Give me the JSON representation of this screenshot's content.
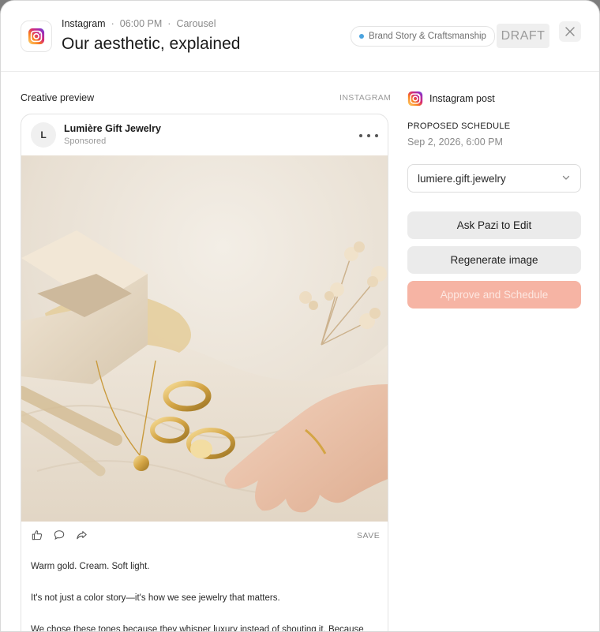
{
  "header": {
    "platform": "Instagram",
    "separator": "·",
    "time": "06:00 PM",
    "format": "Carousel",
    "title": "Our aesthetic, explained",
    "tag": "Brand Story & Craftsmanship",
    "tag_color": "#4aa3df",
    "status": "DRAFT",
    "close_icon": "close-icon"
  },
  "preview": {
    "section_label": "Creative preview",
    "section_platform": "INSTAGRAM",
    "avatar_initial": "L",
    "account_name": "Lumière Gift Jewelry",
    "sponsored_label": "Sponsored",
    "more_icon": "more-icon",
    "image_icon": "jewelry-photo",
    "action_icons": [
      "like-icon",
      "comment-icon",
      "share-icon"
    ],
    "save_label": "SAVE",
    "caption": [
      "Warm gold. Cream. Soft light.",
      "It's not just a color story—it's how we see jewelry that matters.",
      "We chose these tones because they whisper luxury instead of shouting it. Because"
    ]
  },
  "sidebar": {
    "post_kind": "Instagram post",
    "schedule_label": "PROPOSED SCHEDULE",
    "schedule_value": "Sep 2, 2026, 6:00 PM",
    "account_select": "lumiere.gift.jewelry",
    "buttons": {
      "ask": "Ask Pazi to Edit",
      "regenerate": "Regenerate image",
      "approve": "Approve and Schedule"
    },
    "accent_color": "#f6b4a4"
  }
}
